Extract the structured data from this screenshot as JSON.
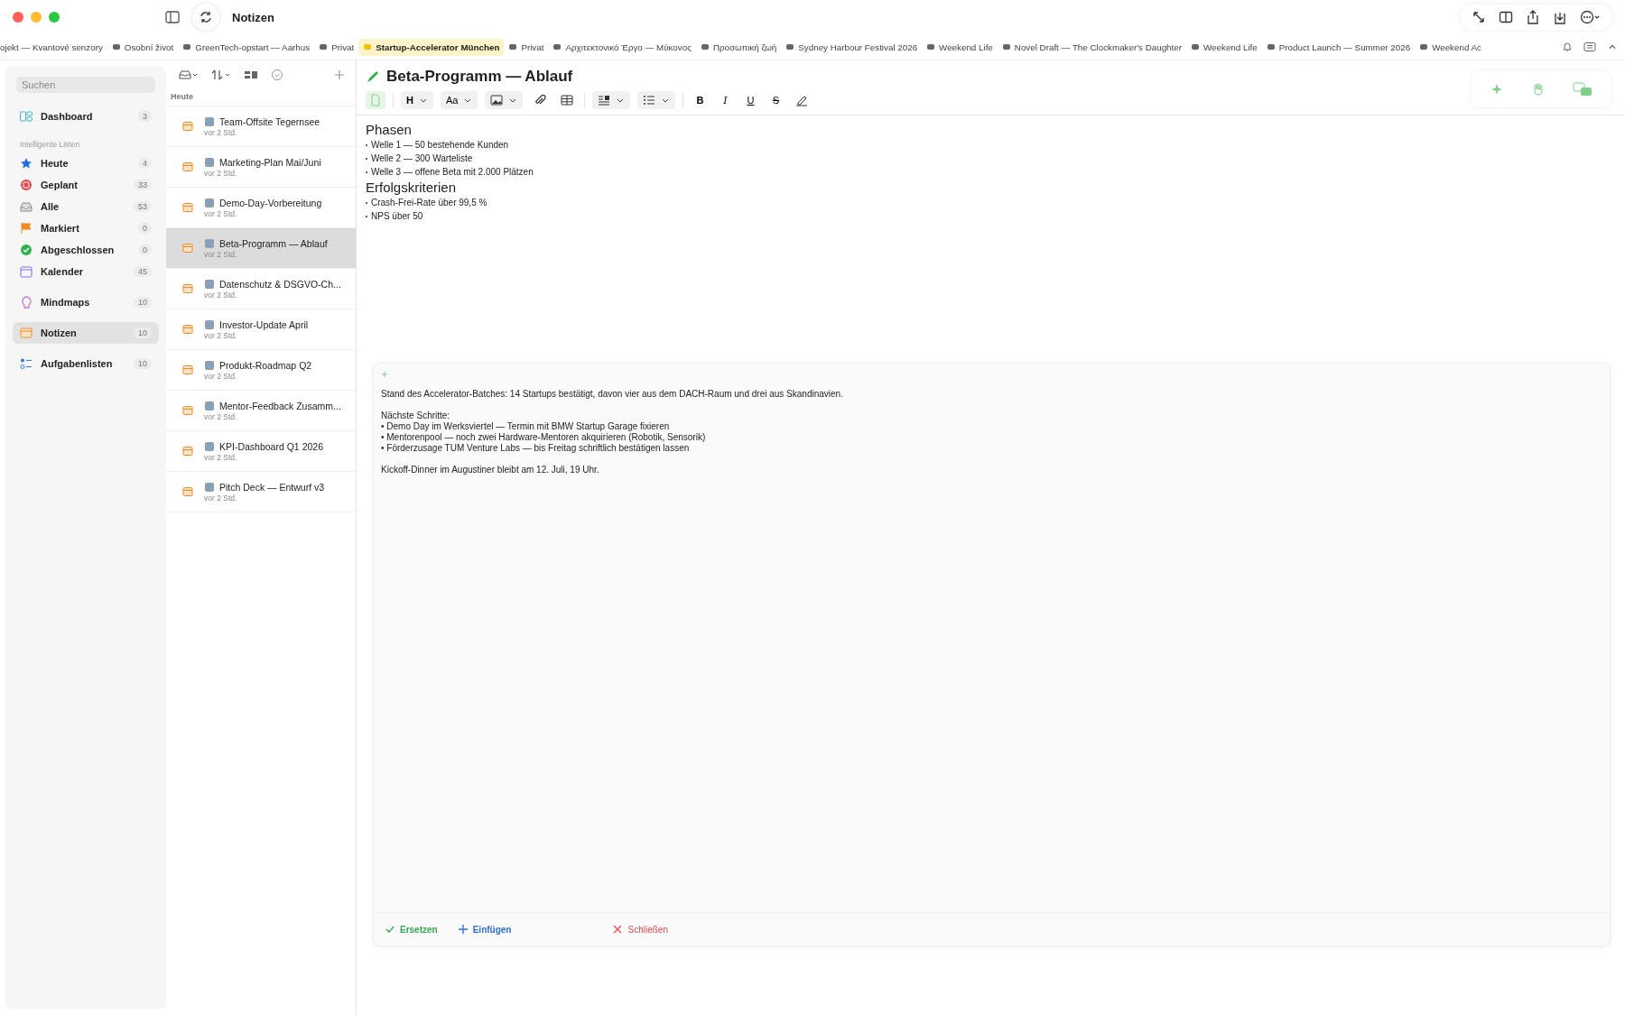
{
  "window": {
    "title": "Notizen"
  },
  "tabs": [
    {
      "label": "ojekt — Kvantové senzory",
      "icon": false,
      "selected": false
    },
    {
      "label": "Osobní život",
      "icon": true,
      "selected": false
    },
    {
      "label": "GreenTech-opstart — Aarhus",
      "icon": true,
      "selected": false
    },
    {
      "label": "Privat",
      "icon": true,
      "selected": false
    },
    {
      "label": "Startup-Accelerator München",
      "icon": true,
      "selected": true
    },
    {
      "label": "Privat",
      "icon": true,
      "selected": false
    },
    {
      "label": "Αρχιτεκτονικό Έργο — Μύκονος",
      "icon": true,
      "selected": false
    },
    {
      "label": "Προσωπική ζωή",
      "icon": true,
      "selected": false
    },
    {
      "label": "Sydney Harbour Festival 2026",
      "icon": true,
      "selected": false
    },
    {
      "label": "Weekend Life",
      "icon": true,
      "selected": false
    },
    {
      "label": "Novel Draft — The Clockmaker's Daughter",
      "icon": true,
      "selected": false
    },
    {
      "label": "Weekend Life",
      "icon": true,
      "selected": false
    },
    {
      "label": "Product Launch — Summer 2026",
      "icon": true,
      "selected": false
    },
    {
      "label": "Weekend Ac",
      "icon": true,
      "selected": false
    }
  ],
  "sidebar": {
    "search": {
      "placeholder": "Suchen"
    },
    "groups": [
      {
        "items": [
          {
            "kind": "dashboard",
            "label": "Dashboard",
            "count": "3",
            "selected": false
          }
        ]
      },
      {
        "heading": "Intelligente Listen",
        "items": [
          {
            "kind": "today",
            "label": "Heute",
            "count": "4",
            "selected": false
          },
          {
            "kind": "planned",
            "label": "Geplant",
            "count": "33",
            "selected": false
          },
          {
            "kind": "all",
            "label": "Alle",
            "count": "53",
            "selected": false
          },
          {
            "kind": "flagged",
            "label": "Markiert",
            "count": "0",
            "selected": false
          },
          {
            "kind": "done",
            "label": "Abgeschlossen",
            "count": "0",
            "selected": false
          },
          {
            "kind": "calendar",
            "label": "Kalender",
            "count": "45",
            "selected": false
          }
        ]
      },
      {
        "items": [
          {
            "kind": "mindmap",
            "label": "Mindmaps",
            "count": "10",
            "selected": false
          }
        ]
      },
      {
        "items": [
          {
            "kind": "note",
            "label": "Notizen",
            "count": "10",
            "selected": true
          }
        ]
      },
      {
        "items": [
          {
            "kind": "tasks",
            "label": "Aufgabenlisten",
            "count": "10",
            "selected": false
          }
        ]
      }
    ]
  },
  "notes": {
    "section": "Heute",
    "items": [
      {
        "title": "Team-Offsite Tegernsee",
        "time": "vor 2 Std.",
        "selected": false
      },
      {
        "title": "Marketing-Plan Mai/Juni",
        "time": "vor 2 Std.",
        "selected": false
      },
      {
        "title": "Demo-Day-Vorbereitung",
        "time": "vor 2 Std.",
        "selected": false
      },
      {
        "title": "Beta-Programm — Ablauf",
        "time": "vor 2 Std.",
        "selected": true
      },
      {
        "title": "Datenschutz & DSGVO-Ch...",
        "time": "vor 2 Std.",
        "selected": false
      },
      {
        "title": "Investor-Update April",
        "time": "vor 2 Std.",
        "selected": false
      },
      {
        "title": "Produkt-Roadmap Q2",
        "time": "vor 2 Std.",
        "selected": false
      },
      {
        "title": "Mentor-Feedback Zusamm...",
        "time": "vor 2 Std.",
        "selected": false
      },
      {
        "title": "KPI-Dashboard Q1 2026",
        "time": "vor 2 Std.",
        "selected": false
      },
      {
        "title": "Pitch Deck — Entwurf v3",
        "time": "vor 2 Std.",
        "selected": false
      }
    ]
  },
  "editor": {
    "title": "Beta-Programm — Ablauf",
    "toolbar": [
      {
        "kind": "doc"
      },
      {
        "kind": "sep"
      },
      {
        "kind": "dropdown",
        "label": "H",
        "bold": true
      },
      {
        "kind": "dropdown",
        "label": "Aa",
        "bold": false
      },
      {
        "kind": "image"
      },
      {
        "kind": "clip"
      },
      {
        "kind": "table"
      },
      {
        "kind": "sep"
      },
      {
        "kind": "align"
      },
      {
        "kind": "list"
      },
      {
        "kind": "sep"
      },
      {
        "kind": "bold",
        "label": "B"
      },
      {
        "kind": "italic",
        "label": "I"
      },
      {
        "kind": "underline",
        "label": "U"
      },
      {
        "kind": "strike",
        "label": "S"
      },
      {
        "kind": "pen"
      }
    ],
    "content": [
      {
        "kind": "heading",
        "text": "Phasen"
      },
      {
        "kind": "bullet",
        "text": "Welle 1 — 50 bestehende Kunden"
      },
      {
        "kind": "bullet",
        "text": "Welle 2 — 300 Warteliste"
      },
      {
        "kind": "bullet",
        "text": "Welle 3 — offene Beta mit 2.000 Plätzen"
      },
      {
        "kind": "heading",
        "text": "Erfolgskriterien"
      },
      {
        "kind": "bullet",
        "text": "Crash-Frei-Rate über 99,5 %"
      },
      {
        "kind": "bullet",
        "text": "NPS über 50"
      }
    ]
  },
  "ai_panel": {
    "paragraphs": [
      [
        "Stand des Accelerator-Batches: 14 Startups bestätigt, davon vier aus dem DACH-Raum und drei aus Skandinavien."
      ],
      [
        "Nächste Schritte:",
        "• Demo Day im Werksviertel — Termin mit BMW Startup Garage fixieren",
        "• Mentorenpool — noch zwei Hardware-Mentoren akquirieren (Robotik, Sensorik)",
        "• Förderzusage TUM Venture Labs — bis Freitag schriftlich bestätigen lassen"
      ],
      [
        "Kickoff-Dinner im Augustiner bleibt am 12. Juli, 19 Uhr."
      ]
    ],
    "actions": [
      {
        "kind": "check",
        "label": "Ersetzen",
        "color": "#34a853"
      },
      {
        "kind": "plus",
        "label": "Einfügen",
        "color": "#2f6fd6"
      },
      {
        "kind": "close",
        "label": "Schließen",
        "color": "#e5484d"
      }
    ]
  }
}
